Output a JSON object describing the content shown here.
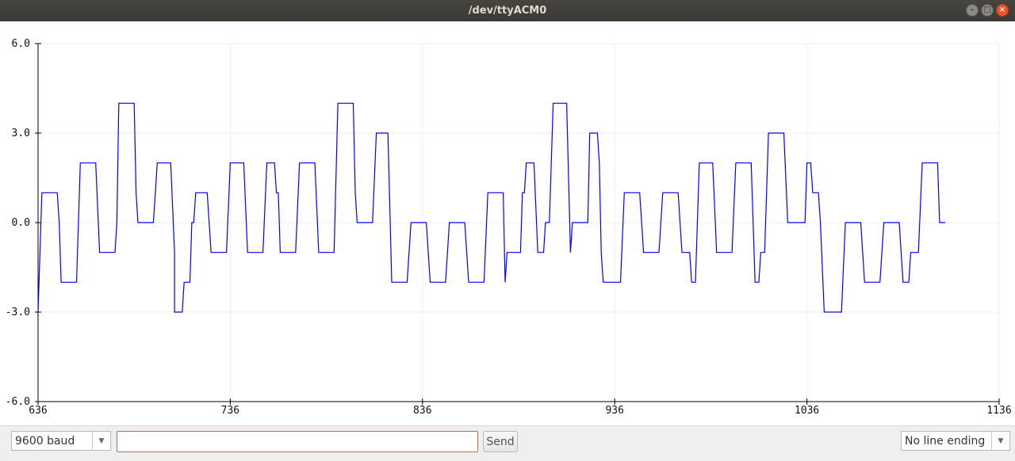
{
  "window": {
    "title": "/dev/ttyACM0"
  },
  "toolbar": {
    "baud_label": "9600 baud",
    "send_input_value": "",
    "send_label": "Send",
    "line_ending_label": "No line ending"
  },
  "colors": {
    "line": "#0000ff",
    "grid": "#eeeeee",
    "axis": "#000000"
  },
  "chart_data": {
    "type": "line",
    "title": "",
    "xlabel": "",
    "ylabel": "",
    "xlim": [
      636,
      1136
    ],
    "ylim": [
      -6.0,
      6.0
    ],
    "x_ticks": [
      636,
      736,
      836,
      936,
      1036,
      1136
    ],
    "x_tick_labels": [
      "636",
      "736",
      "836",
      "936",
      "1036",
      "1136"
    ],
    "y_ticks": [
      6.0,
      3.0,
      0.0,
      -3.0,
      -6.0
    ],
    "y_tick_labels": [
      "6.0",
      "3.0",
      "0.0",
      "-3.0",
      "-6.0"
    ],
    "grid": true,
    "series": [
      {
        "name": "",
        "color": "#0000ff",
        "points": [
          [
            636,
            -3
          ],
          [
            638,
            1
          ],
          [
            646,
            1
          ],
          [
            647,
            0
          ],
          [
            648,
            -2
          ],
          [
            656,
            -2
          ],
          [
            658,
            2
          ],
          [
            666,
            2
          ],
          [
            668,
            -1
          ],
          [
            676,
            -1
          ],
          [
            677,
            0
          ],
          [
            678,
            4
          ],
          [
            686,
            4
          ],
          [
            687,
            1
          ],
          [
            688,
            0
          ],
          [
            696,
            0
          ],
          [
            697,
            1
          ],
          [
            698,
            2
          ],
          [
            705,
            2
          ],
          [
            707,
            -1
          ],
          [
            707,
            -3
          ],
          [
            711,
            -3
          ],
          [
            712,
            -2
          ],
          [
            715,
            -2
          ],
          [
            716,
            0
          ],
          [
            717,
            0
          ],
          [
            718,
            1
          ],
          [
            724,
            1
          ],
          [
            726,
            -1
          ],
          [
            734,
            -1
          ],
          [
            736,
            2
          ],
          [
            743,
            2
          ],
          [
            745,
            -1
          ],
          [
            753,
            -1
          ],
          [
            755,
            2
          ],
          [
            759,
            2
          ],
          [
            760,
            1
          ],
          [
            761,
            1
          ],
          [
            762,
            -1
          ],
          [
            770,
            -1
          ],
          [
            772,
            2
          ],
          [
            780,
            2
          ],
          [
            782,
            -1
          ],
          [
            790,
            -1
          ],
          [
            792,
            4
          ],
          [
            800,
            4
          ],
          [
            801,
            1
          ],
          [
            802,
            0
          ],
          [
            810,
            0
          ],
          [
            812,
            3
          ],
          [
            818,
            3
          ],
          [
            820,
            -2
          ],
          [
            828,
            -2
          ],
          [
            830,
            0
          ],
          [
            838,
            0
          ],
          [
            840,
            -2
          ],
          [
            848,
            -2
          ],
          [
            850,
            0
          ],
          [
            858,
            0
          ],
          [
            860,
            -2
          ],
          [
            868,
            -2
          ],
          [
            870,
            1
          ],
          [
            878,
            1
          ],
          [
            879,
            -2
          ],
          [
            880,
            -1
          ],
          [
            887,
            -1
          ],
          [
            888,
            1
          ],
          [
            889,
            1
          ],
          [
            890,
            2
          ],
          [
            894,
            2
          ],
          [
            896,
            -1
          ],
          [
            899,
            -1
          ],
          [
            900,
            0
          ],
          [
            902,
            0
          ],
          [
            904,
            4
          ],
          [
            911,
            4
          ],
          [
            913,
            -1
          ],
          [
            914,
            0
          ],
          [
            922,
            0
          ],
          [
            923,
            3
          ],
          [
            927,
            3
          ],
          [
            928,
            2
          ],
          [
            929,
            -1
          ],
          [
            930,
            -2
          ],
          [
            939,
            -2
          ],
          [
            941,
            1
          ],
          [
            949,
            1
          ],
          [
            951,
            -1
          ],
          [
            959,
            -1
          ],
          [
            961,
            1
          ],
          [
            969,
            1
          ],
          [
            971,
            -1
          ],
          [
            975,
            -1
          ],
          [
            976,
            -2
          ],
          [
            978,
            -2
          ],
          [
            980,
            2
          ],
          [
            987,
            2
          ],
          [
            989,
            -1
          ],
          [
            997,
            -1
          ],
          [
            999,
            2
          ],
          [
            1007,
            2
          ],
          [
            1009,
            -2
          ],
          [
            1011,
            -2
          ],
          [
            1012,
            -1
          ],
          [
            1014,
            -1
          ],
          [
            1016,
            3
          ],
          [
            1024,
            3
          ],
          [
            1026,
            0
          ],
          [
            1035,
            0
          ],
          [
            1036,
            2
          ],
          [
            1038,
            2
          ],
          [
            1039,
            1
          ],
          [
            1042,
            1
          ],
          [
            1043,
            0
          ],
          [
            1045,
            -3
          ],
          [
            1054,
            -3
          ],
          [
            1056,
            0
          ],
          [
            1064,
            0
          ],
          [
            1066,
            -2
          ],
          [
            1074,
            -2
          ],
          [
            1076,
            0
          ],
          [
            1084,
            0
          ],
          [
            1086,
            -2
          ],
          [
            1089,
            -2
          ],
          [
            1090,
            -1
          ],
          [
            1094,
            -1
          ],
          [
            1096,
            2
          ],
          [
            1104,
            2
          ],
          [
            1105,
            0
          ],
          [
            1108,
            0
          ]
        ]
      }
    ]
  }
}
